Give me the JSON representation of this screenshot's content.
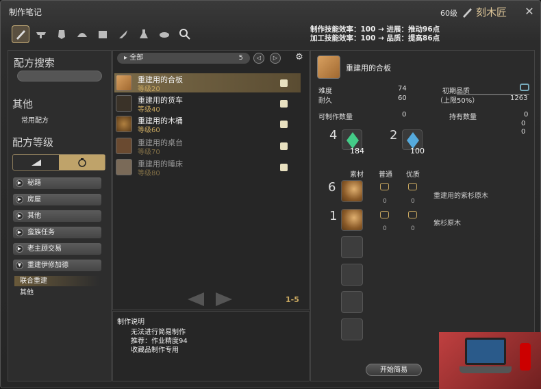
{
  "window": {
    "title": "制作笔记",
    "level": "60级",
    "job": "刻木匠"
  },
  "tabs": [
    "carpenter-icon",
    "blacksmith-icon",
    "armorer-icon",
    "goldsmith-icon",
    "leatherworker-icon",
    "weaver-icon",
    "alchemist-icon",
    "culinarian-icon",
    "search-icon"
  ],
  "bonus": {
    "line1": "制作技能效率：100 → 进展：推动96点",
    "line2": "加工技能效率：100 → 品质：提高86点"
  },
  "sidebar": {
    "search_heading": "配方搜索",
    "other_heading": "其他",
    "common_recipes": "常用配方",
    "level_heading": "配方等级",
    "categories": [
      {
        "label": "秘籍"
      },
      {
        "label": "房屋"
      },
      {
        "label": "其他"
      },
      {
        "label": "蛮族任务"
      },
      {
        "label": "老主顾交易"
      },
      {
        "label": "重建伊修加德"
      }
    ],
    "subitems": [
      {
        "label": "联合重建"
      },
      {
        "label": "其他"
      }
    ]
  },
  "list": {
    "filter": "全部",
    "count": "5",
    "items": [
      {
        "name": "重建用的合板",
        "level": "等级20"
      },
      {
        "name": "重建用的货车",
        "level": "等级40"
      },
      {
        "name": "重建用的木桶",
        "level": "等级60"
      },
      {
        "name": "重建用的桌台",
        "level": "等级70"
      },
      {
        "name": "重建用的睡床",
        "level": "等级80"
      }
    ],
    "pager": "1-5"
  },
  "description": {
    "heading": "制作说明",
    "lines": [
      "无法进行简易制作",
      "推荐：作业精度94",
      "收藏品制作专用"
    ]
  },
  "detail": {
    "item_name": "重建用的合板",
    "difficulty_label": "难度",
    "difficulty": "74",
    "durability_label": "耐久",
    "durability": "60",
    "init_quality_label": "初期品质",
    "init_quality_limit": "（上限50%）",
    "init_quality_max": "1263",
    "craftable_label": "可制作数量",
    "craftable": "0",
    "held_label": "持有数量",
    "held": "0",
    "held_nq": "0",
    "held_hq": "0",
    "crystals": [
      {
        "need": "4",
        "have": "184"
      },
      {
        "need": "2",
        "have": "100"
      }
    ],
    "ing_header": {
      "material": "素材",
      "normal": "普通",
      "hq": "优质"
    },
    "ingredients": [
      {
        "need": "6",
        "name": "重建用的紫杉原木",
        "nq": "0",
        "hq": "0"
      },
      {
        "need": "1",
        "name": "紫杉原木",
        "nq": "0",
        "hq": "0"
      }
    ],
    "start_button": "开始简易"
  },
  "colors": {
    "accent": "#c9a860",
    "selected_row": "#7a6a48"
  }
}
